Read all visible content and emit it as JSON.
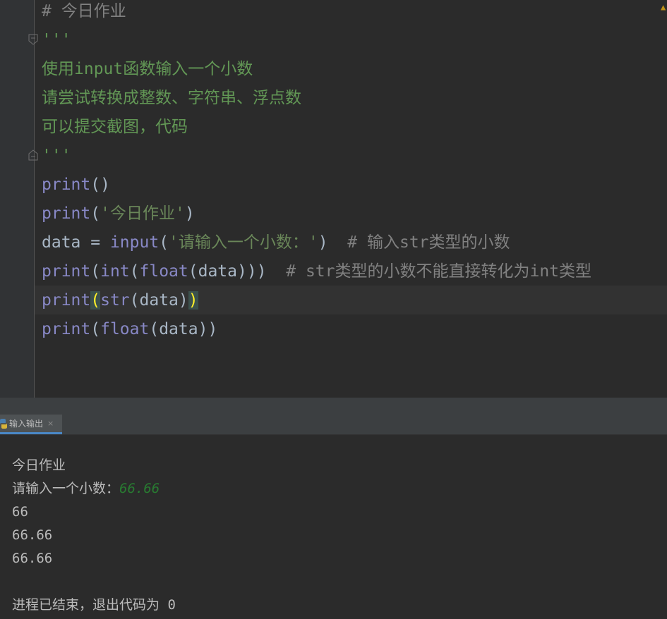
{
  "editor": {
    "lines": [
      {
        "segments": [
          {
            "text": "# 今日作业",
            "cls": "c-comment"
          }
        ]
      },
      {
        "segments": [
          {
            "text": "'''",
            "cls": "c-doc"
          }
        ]
      },
      {
        "segments": [
          {
            "text": "使用input函数输入一个小数",
            "cls": "c-doc"
          }
        ]
      },
      {
        "segments": [
          {
            "text": "请尝试转换成整数、字符串、浮点数",
            "cls": "c-doc"
          }
        ]
      },
      {
        "segments": [
          {
            "text": "可以提交截图，代码",
            "cls": "c-doc"
          }
        ]
      },
      {
        "segments": [
          {
            "text": "'''",
            "cls": "c-doc"
          }
        ]
      },
      {
        "segments": [
          {
            "text": "print",
            "cls": "c-builtin"
          },
          {
            "text": "()",
            "cls": "c-plain"
          }
        ]
      },
      {
        "segments": [
          {
            "text": "print",
            "cls": "c-builtin"
          },
          {
            "text": "(",
            "cls": "c-plain"
          },
          {
            "text": "'今日作业'",
            "cls": "c-string"
          },
          {
            "text": ")",
            "cls": "c-plain"
          }
        ]
      },
      {
        "segments": [
          {
            "text": "data = ",
            "cls": "c-plain"
          },
          {
            "text": "input",
            "cls": "c-builtin"
          },
          {
            "text": "(",
            "cls": "c-plain"
          },
          {
            "text": "'请输入一个小数：'",
            "cls": "c-string"
          },
          {
            "text": ")  ",
            "cls": "c-plain"
          },
          {
            "text": "# 输入str类型的小数",
            "cls": "c-comment"
          }
        ]
      },
      {
        "segments": [
          {
            "text": "print",
            "cls": "c-builtin"
          },
          {
            "text": "(",
            "cls": "c-plain"
          },
          {
            "text": "int",
            "cls": "c-builtin"
          },
          {
            "text": "(",
            "cls": "c-plain"
          },
          {
            "text": "float",
            "cls": "c-builtin"
          },
          {
            "text": "(data)))  ",
            "cls": "c-plain"
          },
          {
            "text": "# str类型的小数不能直接转化为int类型",
            "cls": "c-comment"
          }
        ]
      },
      {
        "segments": [
          {
            "text": "print",
            "cls": "c-builtin"
          },
          {
            "text": "(",
            "cls": "paren-match"
          },
          {
            "text": "str",
            "cls": "c-builtin"
          },
          {
            "text": "(data)",
            "cls": "c-plain"
          },
          {
            "text": ")",
            "cls": "paren-match"
          }
        ]
      },
      {
        "segments": [
          {
            "text": "print",
            "cls": "c-builtin"
          },
          {
            "text": "(",
            "cls": "c-plain"
          },
          {
            "text": "float",
            "cls": "c-builtin"
          },
          {
            "text": "(data))",
            "cls": "c-plain"
          }
        ]
      }
    ]
  },
  "tool_window": {
    "tab_label": "输入输出",
    "tab_close": "×",
    "tab_icon": "python-icon"
  },
  "console": {
    "line1": "今日作业",
    "prompt": "请输入一个小数：",
    "user_input": "66.66",
    "line3": "66",
    "line4": "66.66",
    "line5": "66.66",
    "exit_message": "进程已结束，退出代码为 0"
  },
  "colors": {
    "comment": "#808080",
    "docstring": "#629755",
    "string": "#6a8759",
    "builtin": "#8888c6",
    "input_green": "#287b31",
    "tab_underline": "#4a88c7"
  }
}
